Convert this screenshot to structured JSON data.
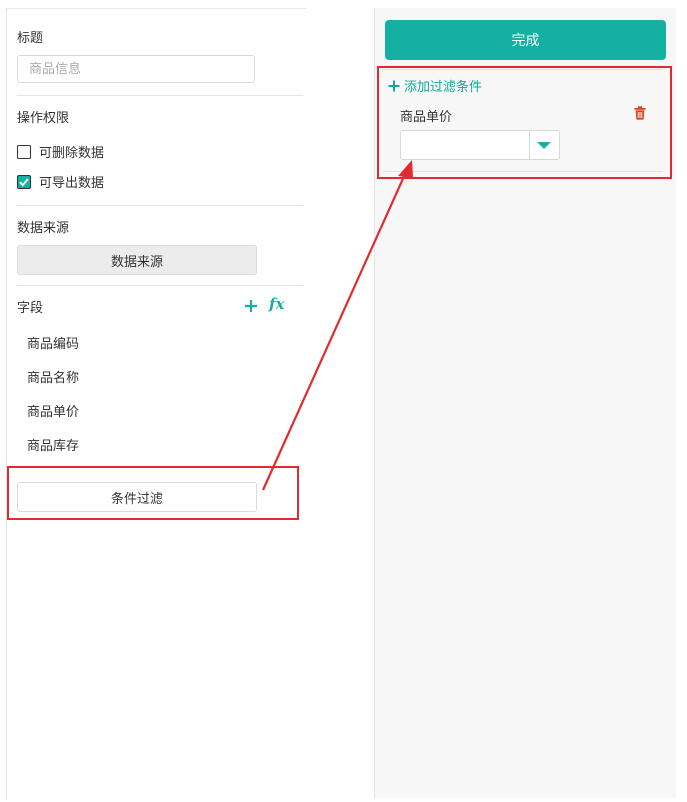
{
  "left_panel": {
    "title_section": {
      "label": "标题",
      "input_placeholder": "商品信息",
      "input_value": ""
    },
    "permissions_section": {
      "label": "操作权限",
      "checkboxes": [
        {
          "label": "可删除数据",
          "checked": false
        },
        {
          "label": "可导出数据",
          "checked": true
        }
      ]
    },
    "datasource_section": {
      "label": "数据来源",
      "button_label": "数据来源"
    },
    "fields_section": {
      "label": "字段",
      "add_icon": "plus-icon",
      "formula_icon": "fx-icon",
      "fields": [
        "商品编码",
        "商品名称",
        "商品单价",
        "商品库存"
      ]
    },
    "filter_button_label": "条件过滤"
  },
  "right_panel": {
    "done_button_label": "完成",
    "add_filter_label": "添加过滤条件",
    "filter_condition": {
      "field_label": "商品单价",
      "select_value": "",
      "delete_icon": "trash-icon"
    }
  },
  "colors": {
    "accent": "#14b1a2",
    "highlight": "#e02c2c",
    "delete": "#d9441a"
  }
}
